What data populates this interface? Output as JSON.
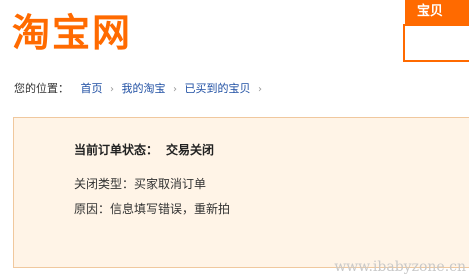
{
  "header": {
    "logo_text": "淘宝网",
    "search_tab_label": "宝贝",
    "search_input_value": ""
  },
  "breadcrumb": {
    "prefix": "您的位置：",
    "items": [
      "首页",
      "我的淘宝",
      "已买到的宝贝"
    ],
    "separator_icon": "chevron-right-icon"
  },
  "order": {
    "status_label": "当前订单状态：",
    "status_value": "交易关闭",
    "close_type_label": "关闭类型：",
    "close_type_value": "买家取消订单",
    "reason_label": "原因：",
    "reason_value": "信息填写错误，重新拍"
  },
  "watermark": "www.ibabyzone.cn",
  "colors": {
    "brand_orange": "#ff6a00",
    "link_blue": "#1f4fa3",
    "panel_bg": "#fff4e7",
    "panel_border": "#f0c89e"
  }
}
